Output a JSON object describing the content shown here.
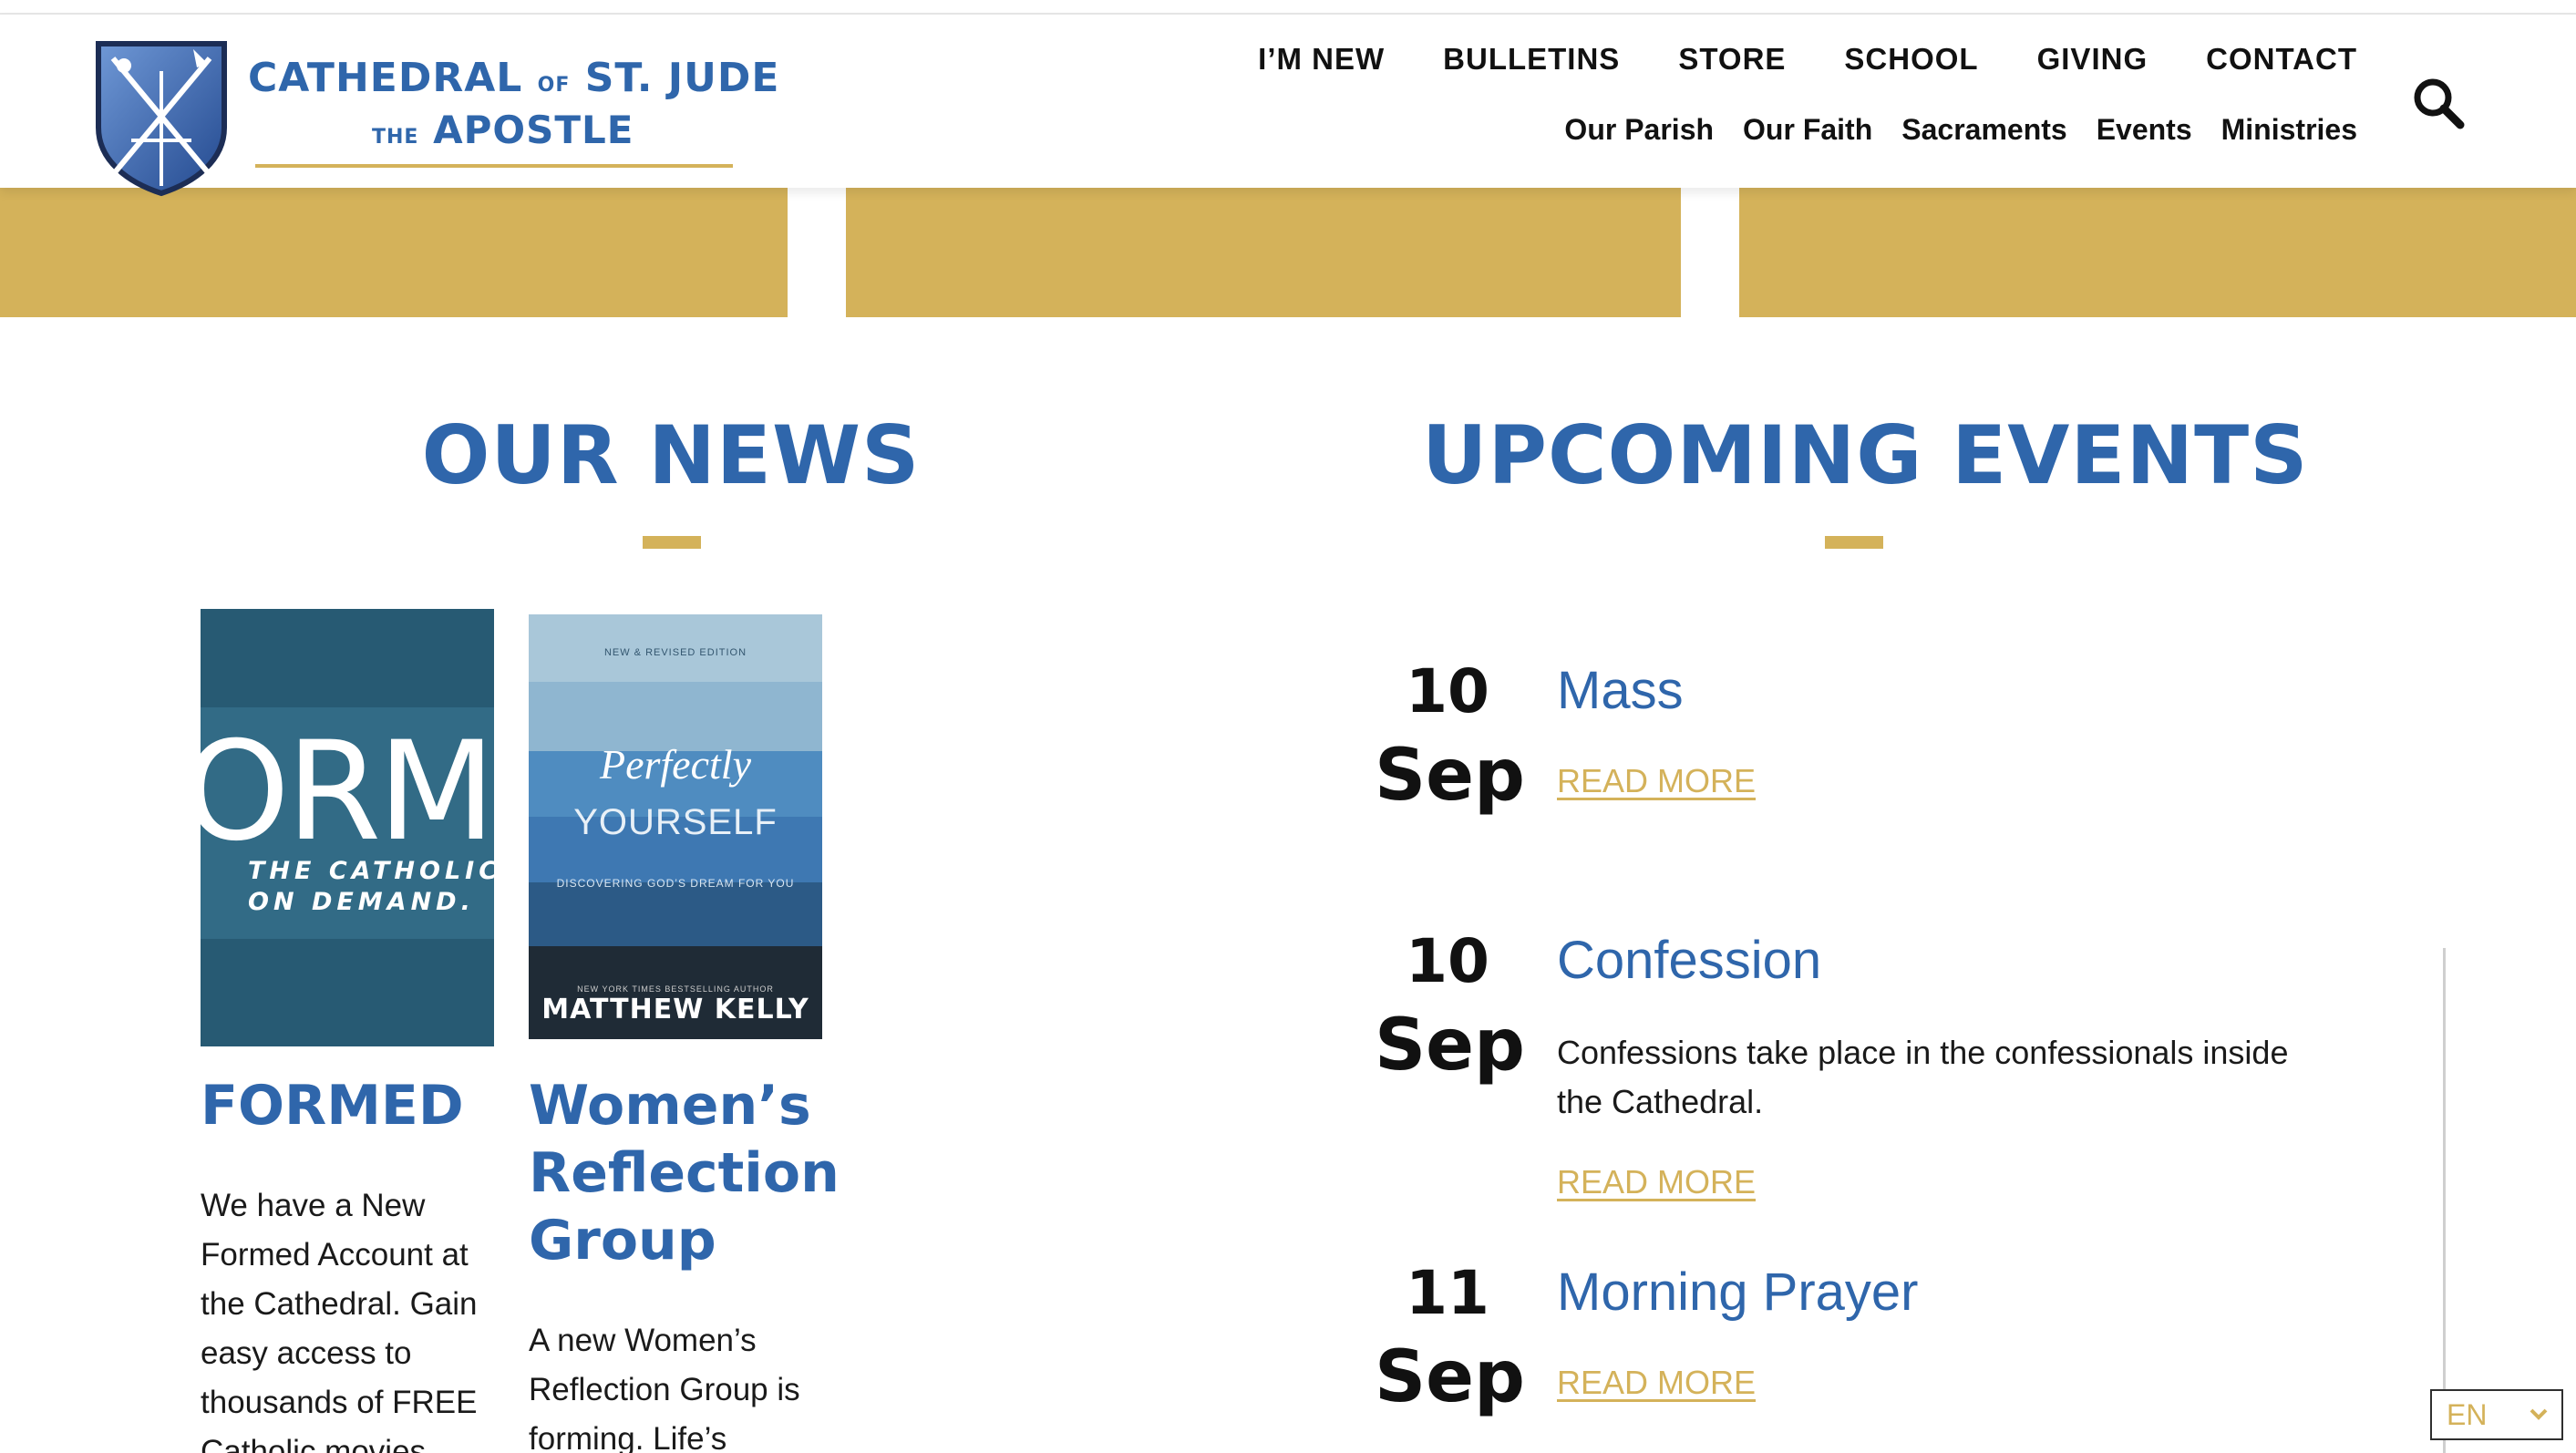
{
  "brand": {
    "line1_a": "CATHEDRAL",
    "line1_small": "OF",
    "line1_b": "ST. JUDE",
    "line2_small": "THE",
    "line2_b": "APOSTLE"
  },
  "nav": {
    "primary": [
      "I’M NEW",
      "BULLETINS",
      "STORE",
      "SCHOOL",
      "GIVING",
      "CONTACT"
    ],
    "secondary": [
      "Our Parish",
      "Our Faith",
      "Sacraments",
      "Events",
      "Ministries"
    ]
  },
  "colors": {
    "blue": "#2f66ab",
    "gold": "#d4b25a",
    "dark": "#111111"
  },
  "icons": {
    "search": "search-icon",
    "chevron": "chevron-down-icon",
    "logo": "cathedral-shield-icon"
  },
  "news": {
    "heading": "OUR NEWS",
    "items": [
      {
        "title": "FORMED",
        "image_text_big": "ORME",
        "image_text_small_1": "THE CATHOLIC",
        "image_text_small_2": "ON DEMAND.",
        "body": "We have a New Formed Account at the Cathedral. Gain easy access to thousands of FREE Catholic movies"
      },
      {
        "title": "Women’s Reflection Group",
        "cover_edition": "NEW & REVISED EDITION",
        "cover_title_1": "Perfectly",
        "cover_title_2": "YOURSELF",
        "cover_subtitle": "DISCOVERING GOD’S DREAM FOR YOU",
        "cover_tagline": "NEW YORK TIMES BESTSELLING AUTHOR",
        "cover_author": "MATTHEW KELLY",
        "body": "A new Women’s Reflection Group is forming. Life’s"
      }
    ]
  },
  "events": {
    "heading": "UPCOMING EVENTS",
    "read_more": "READ MORE",
    "items": [
      {
        "day": "10",
        "month": "Sep",
        "title": "Mass",
        "desc": ""
      },
      {
        "day": "10",
        "month": "Sep",
        "title": "Confession",
        "desc": "Confessions take place in the confessionals inside the Cathedral."
      },
      {
        "day": "11",
        "month": "Sep",
        "title": "Morning Prayer",
        "desc": ""
      }
    ]
  },
  "language": {
    "selected": "EN"
  }
}
